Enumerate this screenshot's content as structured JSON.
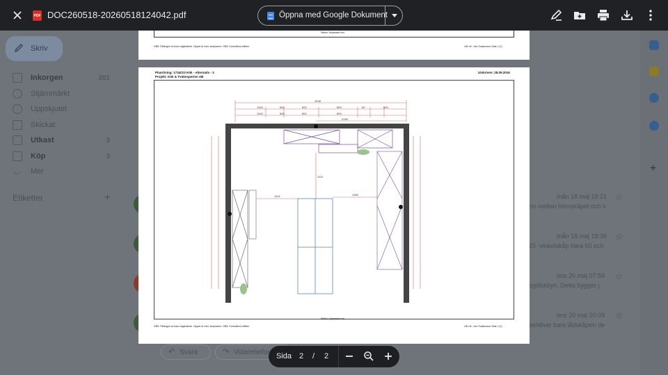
{
  "viewer": {
    "filename": "DOC260518-20260518124042.pdf",
    "file_badge": "PDF",
    "open_with_label": "Öppna med Google Dokument"
  },
  "gmail": {
    "compose_label": "Skriv",
    "nav": [
      {
        "label": "Inkorgen",
        "count": "201"
      },
      {
        "label": "Stjärnmärkt",
        "count": ""
      },
      {
        "label": "Uppskjutet",
        "count": ""
      },
      {
        "label": "Skickat",
        "count": ""
      },
      {
        "label": "Utkast",
        "count": "3"
      },
      {
        "label": "Köp",
        "count": "3"
      },
      {
        "label": "Mer",
        "count": ""
      }
    ],
    "labels_heading": "Etiketter",
    "messages": [
      {
        "date": "mån 18 maj 18:21",
        "snippet": "rm mellan hörnskåpet och s"
      },
      {
        "date": "mån 18 maj 18:36",
        "snippet": "25 -vinkelskåp bara 60 och"
      },
      {
        "date": "ons 20 maj 07:59",
        "snippet": "ögdiskbyn. Detta bygger j"
      },
      {
        "date": "ons 20 maj 20:03",
        "snippet": "behöver bara lådskåpen de"
      }
    ],
    "reply_label": "Svara",
    "forward_label": "Vidarebefordra"
  },
  "prev_page": {
    "status": "Status: Anpassad rum",
    "footer_left": "OBS: Ritningen är bara vägledande. Djupet är exkl. stolpluckor. OBS: Kontrollera måtten.",
    "footer_right": "Vår ref.: Jan Gustavsson     Sida 1 (1)"
  },
  "cur_page": {
    "plan_label": "Planritning:  1734/1/3  Kök - Alternativ - 3",
    "project_label": "Projekt:   Kök & Tvättesperten AB",
    "printed_label": "Utskriven: 28.09.2016",
    "status": "Status: Anpassad rum",
    "footer_left": "OBS: Ritningen är bara vägledande. Djupet är exkl. stolpluckor. OBS: Kontrollera måtten.",
    "footer_right": "Vår ref.: Jan Gustavsson     Sida 1 (1)",
    "dims_top": [
      "4208",
      "1342",
      "600",
      "800",
      "800",
      "50",
      "600",
      "2250"
    ],
    "dims_mid": [
      "1119",
      "1060",
      "1112"
    ]
  },
  "pager": {
    "label": "Sida",
    "current": "2",
    "separator": "/",
    "total": "2"
  },
  "colors": {
    "viewer_bar": "#202124",
    "dim_overlay": "#6f737a",
    "pdf_red": "#d93025",
    "docs_blue": "#4285f4"
  }
}
